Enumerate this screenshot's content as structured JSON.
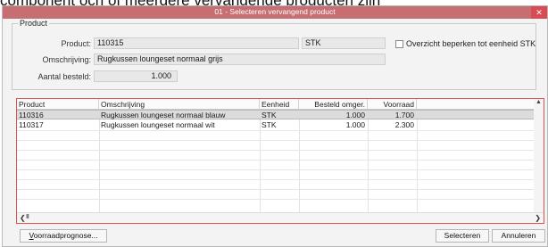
{
  "background_text": "component ocn of meerdere vervangende producten zijn",
  "window": {
    "title": "01 - Selecteren vervangend product",
    "close_glyph": "✕"
  },
  "product_group": {
    "label": "Product",
    "product_label": "Product:",
    "product_value": "110315",
    "unit_value": "STK",
    "description_label": "Omschrijving:",
    "description_value": "Rugkussen loungeset normaal grijs",
    "ordered_label": "Aantal besteld:",
    "ordered_value": "1.000",
    "filter_checkbox_label": "Overzicht beperken tot eenheid STK",
    "filter_checked": false
  },
  "grid": {
    "columns": [
      "Product",
      "Omschrijving",
      "Eenheid",
      "Besteld omger.",
      "Voorraad"
    ],
    "rows": [
      {
        "product": "110316",
        "description": "Rugkussen loungeset normaal blauw",
        "unit": "STK",
        "ordered": "1.000",
        "stock": "1.700",
        "selected": true
      },
      {
        "product": "110317",
        "description": "Rugkussen loungeset normaal wit",
        "unit": "STK",
        "ordered": "1.000",
        "stock": "2.300",
        "selected": false
      }
    ],
    "scroll_thumb": "III"
  },
  "buttons": {
    "forecast_prefix": "V",
    "forecast_rest": "oorraadprognose...",
    "select": "Selecteren",
    "cancel": "Annuleren"
  },
  "colors": {
    "title_bar": "#c76e72",
    "close": "#d94a52",
    "grid_border": "#d9534f",
    "selected_row": "#dcdcdc"
  }
}
